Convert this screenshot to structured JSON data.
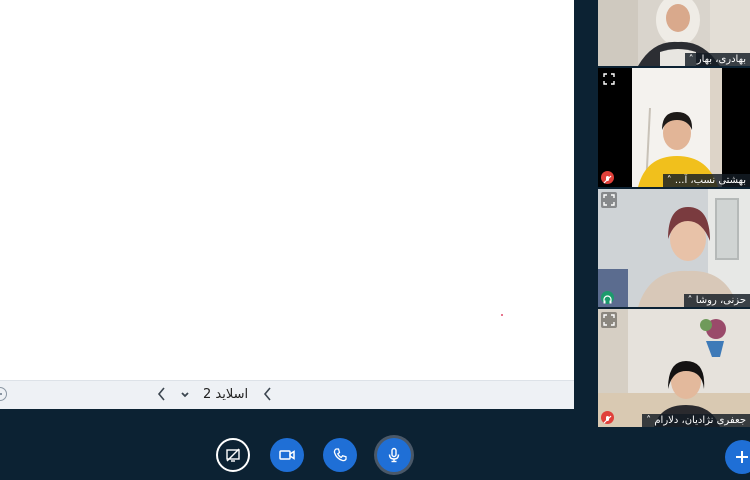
{
  "presentation": {
    "slide_label": "اسلاید 2"
  },
  "participants": [
    {
      "name": "بهادری، بهار",
      "status": "none",
      "active": true
    },
    {
      "name": "بهشتی نسب، آ...",
      "status": "muted"
    },
    {
      "name": "حزنی، روشا",
      "status": "listening"
    },
    {
      "name": "جعفری نژادیان، دلارام",
      "status": "muted"
    }
  ],
  "controls": {
    "screen_share": "screen-share-off-icon",
    "camera": "video-camera-icon",
    "leave_audio": "phone-icon",
    "microphone": "microphone-icon",
    "actions": "plus-icon"
  },
  "colors": {
    "background": "#0c2233",
    "accent_blue": "#1f6fd6",
    "muted_red": "#e0403a",
    "listening_green": "#1c9a6c"
  }
}
